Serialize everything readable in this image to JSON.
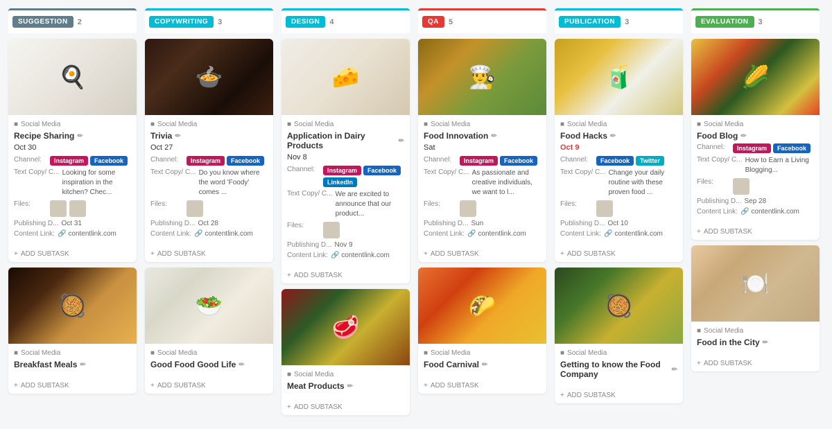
{
  "columns": [
    {
      "id": "suggestion",
      "badge": "SUGGESTION",
      "color": "#607d8b",
      "count": "2",
      "cards": [
        {
          "imageClass": "img-food-1",
          "imageEmoji": "🍳",
          "category": "Social Media",
          "title": "Recipe Sharing",
          "date": "Oct 30",
          "dateOverdue": false,
          "channels": [],
          "channelLabel": "Channel:",
          "channelTags": [
            {
              "label": "Instagram",
              "class": "tag-instagram"
            },
            {
              "label": "Facebook",
              "class": "tag-facebook"
            }
          ],
          "textCopyLabel": "Text Copy/ C...",
          "textPreview": "Looking for some inspiration in the kitchen? Chec...",
          "filesLabel": "Files:",
          "filesCount": 2,
          "publishingLabel": "Publishing D...",
          "publishingDate": "Oct 31",
          "contentLinkLabel": "Content Link:",
          "contentLink": "contentlink.com"
        },
        {
          "imageClass": "img-food-7",
          "imageEmoji": "🥘",
          "category": "Social Media",
          "title": "Breakfast Meals",
          "date": "",
          "dateOverdue": false,
          "channelTags": [],
          "textCopyLabel": "",
          "textPreview": "",
          "filesLabel": "",
          "publishingLabel": "",
          "contentLinkLabel": "",
          "contentLink": ""
        }
      ]
    },
    {
      "id": "copywriting",
      "badge": "COPYWRITING",
      "color": "#00bcd4",
      "count": "3",
      "cards": [
        {
          "imageClass": "img-food-2",
          "imageEmoji": "🍲",
          "category": "Social Media",
          "title": "Trivia",
          "date": "Oct 27",
          "dateOverdue": false,
          "channelLabel": "Channel:",
          "channelTags": [
            {
              "label": "Instagram",
              "class": "tag-instagram"
            },
            {
              "label": "Facebook",
              "class": "tag-facebook"
            }
          ],
          "textCopyLabel": "Text Copy/ C...",
          "textPreview": "Do you know where the word 'Foody' comes ...",
          "filesLabel": "Files:",
          "filesCount": 1,
          "publishingLabel": "Publishing D...",
          "publishingDate": "Oct 28",
          "contentLinkLabel": "Content Link:",
          "contentLink": "contentlink.com"
        },
        {
          "imageClass": "img-food-8",
          "imageEmoji": "🥗",
          "category": "Social Media",
          "title": "Good Food Good Life",
          "date": "",
          "dateOverdue": false,
          "channelTags": [],
          "textCopyLabel": "",
          "textPreview": "",
          "filesLabel": "",
          "publishingLabel": "",
          "contentLinkLabel": "",
          "contentLink": ""
        }
      ]
    },
    {
      "id": "design",
      "badge": "DESIGN",
      "color": "#00bcd4",
      "count": "4",
      "cards": [
        {
          "imageClass": "img-food-3",
          "imageEmoji": "🧀",
          "category": "Social Media",
          "title": "Application in Dairy Products",
          "date": "Nov 8",
          "dateOverdue": false,
          "channelLabel": "Channel:",
          "channelTags": [
            {
              "label": "Instagram",
              "class": "tag-instagram"
            },
            {
              "label": "Facebook",
              "class": "tag-facebook"
            },
            {
              "label": "LinkedIn",
              "class": "tag-linkedin"
            }
          ],
          "textCopyLabel": "Text Copy/ C...",
          "textPreview": "We are excited to announce that our product...",
          "filesLabel": "Files:",
          "filesCount": 1,
          "publishingLabel": "Publishing D...",
          "publishingDate": "Nov 9",
          "contentLinkLabel": "Content Link:",
          "contentLink": "contentlink.com"
        },
        {
          "imageClass": "img-food-9",
          "imageEmoji": "🥩",
          "category": "Social Media",
          "title": "Meat Products",
          "date": "",
          "dateOverdue": false,
          "channelTags": [],
          "textCopyLabel": "",
          "textPreview": "",
          "filesLabel": "",
          "publishingLabel": "",
          "contentLinkLabel": "",
          "contentLink": ""
        }
      ]
    },
    {
      "id": "qa",
      "badge": "QA",
      "color": "#e53935",
      "count": "5",
      "cards": [
        {
          "imageClass": "img-food-4",
          "imageEmoji": "👨‍🍳",
          "category": "Social Media",
          "title": "Food Innovation",
          "date": "Sat",
          "dateOverdue": false,
          "channelLabel": "Channel:",
          "channelTags": [
            {
              "label": "Instagram",
              "class": "tag-instagram"
            },
            {
              "label": "Facebook",
              "class": "tag-facebook"
            }
          ],
          "textCopyLabel": "Text Copy/ C...",
          "textPreview": "As passionate and creative individuals, we want to l...",
          "filesLabel": "Files:",
          "filesCount": 1,
          "publishingLabel": "Publishing D...",
          "publishingDate": "Sun",
          "contentLinkLabel": "Content Link:",
          "contentLink": "contentlink.com"
        },
        {
          "imageClass": "img-food-10",
          "imageEmoji": "🌮",
          "category": "Social Media",
          "title": "Food Carnival",
          "date": "",
          "dateOverdue": false,
          "channelTags": [],
          "textCopyLabel": "",
          "textPreview": "",
          "filesLabel": "",
          "publishingLabel": "",
          "contentLinkLabel": "",
          "contentLink": ""
        }
      ]
    },
    {
      "id": "publication",
      "badge": "PUBLICATION",
      "color": "#00bcd4",
      "count": "3",
      "cards": [
        {
          "imageClass": "img-food-5",
          "imageEmoji": "🧃",
          "category": "Social Media",
          "title": "Food Hacks",
          "date": "Oct 9",
          "dateOverdue": true,
          "channelLabel": "Channel:",
          "channelTags": [
            {
              "label": "Facebook",
              "class": "tag-facebook"
            },
            {
              "label": "Twitter",
              "class": "tag-twitter"
            }
          ],
          "textCopyLabel": "Text Copy/ C...",
          "textPreview": "Change your daily routine with these proven food ...",
          "filesLabel": "Files:",
          "filesCount": 1,
          "publishingLabel": "Publishing D...",
          "publishingDate": "Oct 10",
          "contentLinkLabel": "Content Link:",
          "contentLink": "contentlink.com"
        },
        {
          "imageClass": "img-food-11",
          "imageEmoji": "🥘",
          "category": "Social Media",
          "title": "Getting to know the Food Company",
          "date": "",
          "dateOverdue": false,
          "channelTags": [],
          "textCopyLabel": "",
          "textPreview": "",
          "filesLabel": "",
          "publishingLabel": "",
          "contentLinkLabel": "",
          "contentLink": ""
        }
      ]
    },
    {
      "id": "evaluation",
      "badge": "EVALUATION",
      "color": "#4caf50",
      "count": "3",
      "cards": [
        {
          "imageClass": "img-food-6",
          "imageEmoji": "🌽",
          "category": "Social Media",
          "title": "Food Blog",
          "date": "",
          "dateOverdue": false,
          "channelLabel": "Channel:",
          "channelTags": [
            {
              "label": "Instagram",
              "class": "tag-instagram"
            },
            {
              "label": "Facebook",
              "class": "tag-facebook"
            }
          ],
          "textCopyLabel": "Text Copy/ C...",
          "textPreview": "How to Earn a Living Blogging...",
          "filesLabel": "Files:",
          "filesCount": 1,
          "publishingLabel": "Publishing D...",
          "publishingDate": "Sep 28",
          "contentLinkLabel": "Content Link:",
          "contentLink": "contentlink.com"
        },
        {
          "imageClass": "img-food-12",
          "imageEmoji": "🍽️",
          "category": "Social Media",
          "title": "Food in the City",
          "date": "",
          "dateOverdue": false,
          "channelTags": [],
          "textCopyLabel": "",
          "textPreview": "",
          "filesLabel": "",
          "publishingLabel": "",
          "contentLinkLabel": "",
          "contentLink": ""
        }
      ]
    }
  ],
  "addSubtask": "+ ADD SUBTASK",
  "editIcon": "✏️",
  "linkIcon": "🔗",
  "categoryDot": "●"
}
